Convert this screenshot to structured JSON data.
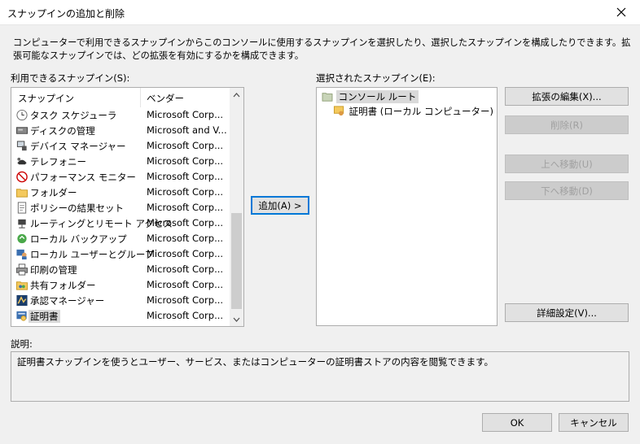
{
  "window": {
    "title": "スナップインの追加と削除"
  },
  "description": "コンピューターで利用できるスナップインからこのコンソールに使用するスナップインを選択したり、選択したスナップインを構成したりできます。拡張可能なスナップインでは、どの拡張を有効にするかを構成できます。",
  "available": {
    "label": "利用できるスナップイン(S):",
    "col_snapin": "スナップイン",
    "col_vendor": "ベンダー",
    "items": [
      {
        "name": "タスク スケジューラ",
        "vendor": "Microsoft Corp...",
        "icon": "clock-icon"
      },
      {
        "name": "ディスクの管理",
        "vendor": "Microsoft and V...",
        "icon": "disk-icon"
      },
      {
        "name": "デバイス マネージャー",
        "vendor": "Microsoft Corp...",
        "icon": "device-icon"
      },
      {
        "name": "テレフォニー",
        "vendor": "Microsoft Corp...",
        "icon": "phone-icon"
      },
      {
        "name": "パフォーマンス モニター",
        "vendor": "Microsoft Corp...",
        "icon": "perfmon-icon"
      },
      {
        "name": "フォルダー",
        "vendor": "Microsoft Corp...",
        "icon": "folder-icon"
      },
      {
        "name": "ポリシーの結果セット",
        "vendor": "Microsoft Corp...",
        "icon": "policy-icon"
      },
      {
        "name": "ルーティングとリモート アクセス",
        "vendor": "Microsoft Corp...",
        "icon": "routing-icon"
      },
      {
        "name": "ローカル バックアップ",
        "vendor": "Microsoft Corp...",
        "icon": "backup-icon"
      },
      {
        "name": "ローカル ユーザーとグループ",
        "vendor": "Microsoft Corp...",
        "icon": "users-icon"
      },
      {
        "name": "印刷の管理",
        "vendor": "Microsoft Corp...",
        "icon": "printer-icon"
      },
      {
        "name": "共有フォルダー",
        "vendor": "Microsoft Corp...",
        "icon": "shared-folder-icon"
      },
      {
        "name": "承認マネージャー",
        "vendor": "Microsoft Corp...",
        "icon": "authz-icon"
      },
      {
        "name": "証明書",
        "vendor": "Microsoft Corp...",
        "icon": "certificate-icon"
      }
    ]
  },
  "add_button": "追加(A) >",
  "selected": {
    "label": "選択されたスナップイン(E):",
    "root": "コンソール ルート",
    "child": "証明書 (ローカル コンピューター)"
  },
  "buttons": {
    "edit_extensions": "拡張の編集(X)...",
    "remove": "削除(R)",
    "move_up": "上へ移動(U)",
    "move_down": "下へ移動(D)",
    "advanced": "詳細設定(V)...",
    "ok": "OK",
    "cancel": "キャンセル"
  },
  "explanation": {
    "label": "説明:",
    "text": "証明書スナップインを使うとユーザー、サービス、またはコンピューターの証明書ストアの内容を閲覧できます。"
  }
}
